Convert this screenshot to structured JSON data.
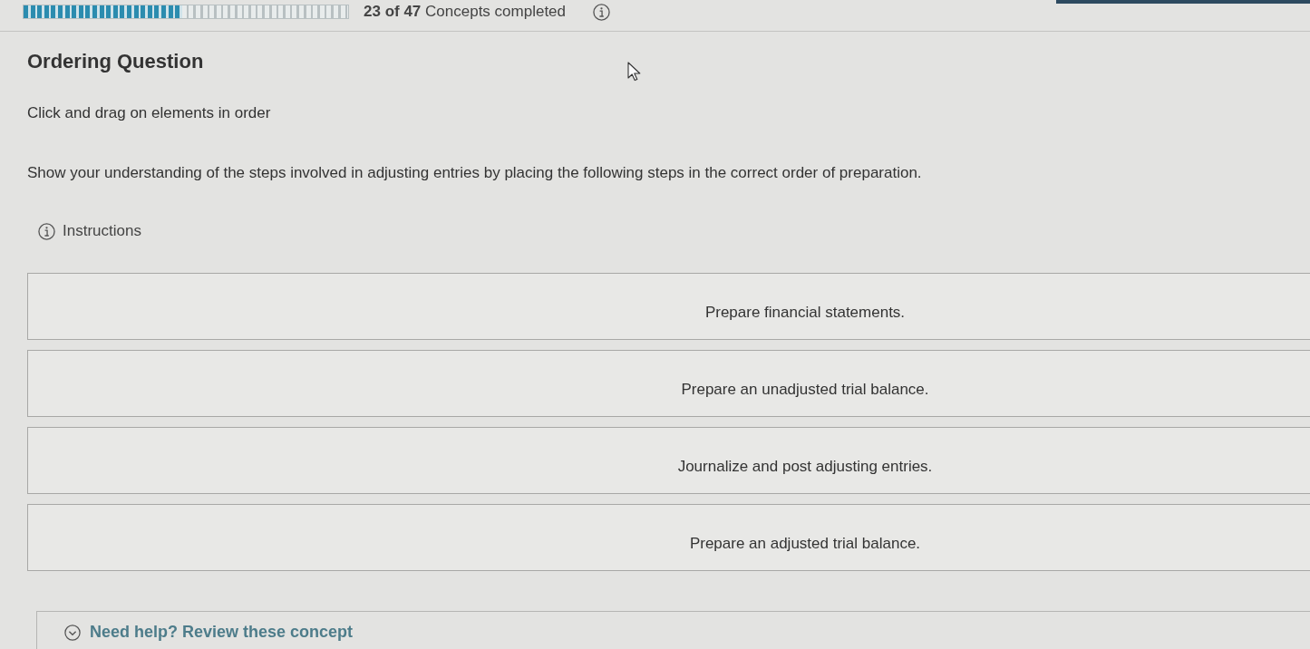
{
  "progress": {
    "level": 0.489,
    "text": "**23 of 47** Concepts completed"
  },
  "question": {
    "heading": "Ordering Question",
    "prompt": "Click and drag on elements in order",
    "body": "Show your understanding of the steps involved in adjusting entries by placing the following steps in the correct order of preparation.",
    "instructions": "Instructions"
  },
  "items": [
    {
      "text": "Prepare financial statements."
    },
    {
      "text": "Prepare an unadjusted trial balance."
    },
    {
      "text": "Journalize and post adjusting entries."
    },
    {
      "text": "Prepare an adjusted trial balance."
    }
  ],
  "help": {
    "text": "Need help? Review these concept"
  }
}
